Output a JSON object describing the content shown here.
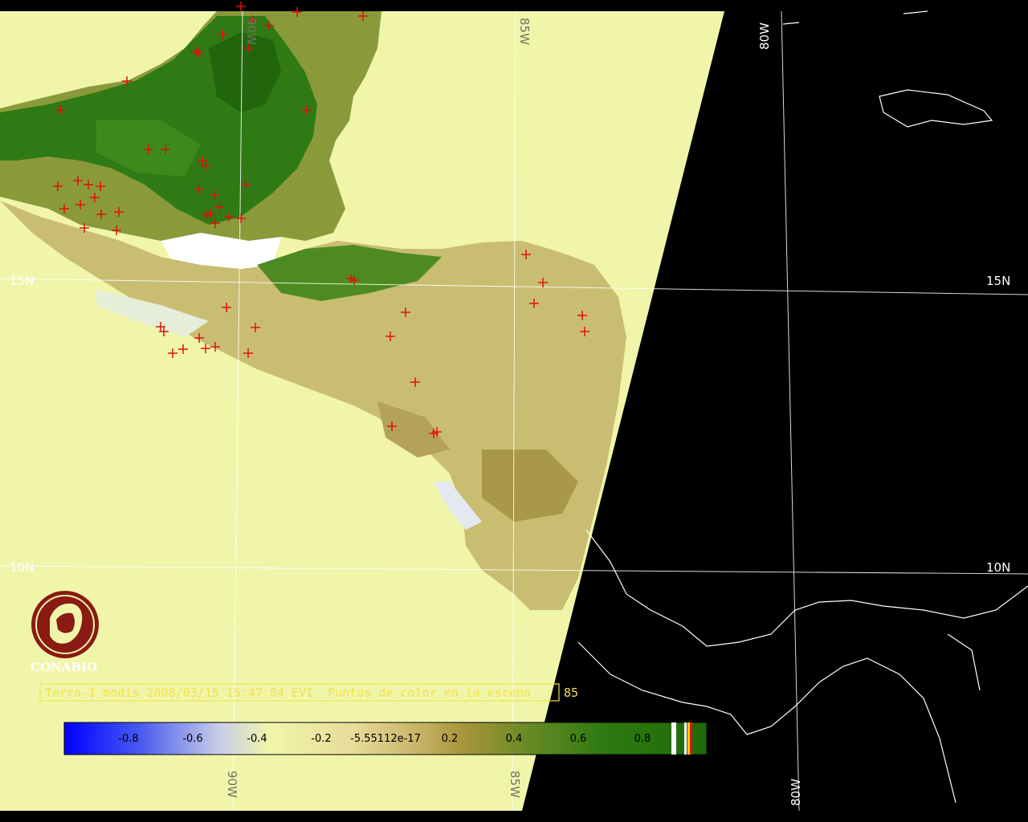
{
  "grid": {
    "lat_label_15": "15N",
    "lat_label_10": "10N",
    "lon_label_90": "90W",
    "lon_label_85": "85W",
    "lon_label_80": "80W"
  },
  "caption": {
    "text": "Terra-1 modis 2008/03/15 15:47:04 EVI. Puntos de color en la escena",
    "count": "85"
  },
  "logo": {
    "name": "CONABIO"
  },
  "colorbar": {
    "ticks": [
      "-0.8",
      "-0.6",
      "-0.4",
      "-0.2",
      "-5.55112e-17",
      "0.2",
      "0.4",
      "0.6",
      "0.8"
    ]
  },
  "colors": {
    "no_data_fill": "#f0f5aa",
    "night_side": "#000000",
    "coastline": "#ffffff",
    "hotspot": "#e01010",
    "veg_high": "#2e7a10"
  },
  "hotspots": {
    "count_shown": 85
  }
}
